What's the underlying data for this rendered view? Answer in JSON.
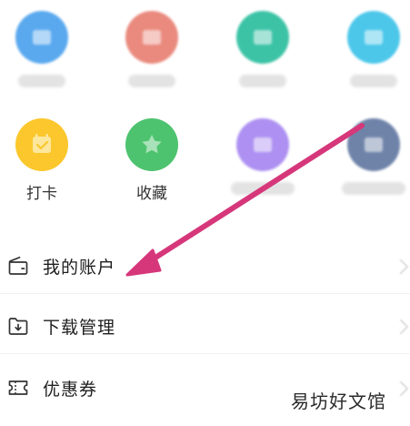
{
  "grid": {
    "row1": [
      {
        "color": "#5aa9ee",
        "label_blurred": true
      },
      {
        "color": "#ea8a7e",
        "label_blurred": true
      },
      {
        "color": "#3cc3a6",
        "label_blurred": true
      },
      {
        "color": "#4cc7ea",
        "label_blurred": true
      }
    ],
    "row2": [
      {
        "color": "#fbc72c",
        "label": "打卡",
        "icon": "calendar-check-icon"
      },
      {
        "color": "#4ec36f",
        "label": "收藏",
        "icon": "star-icon"
      },
      {
        "color": "#ad90f2",
        "label_blurred": true
      },
      {
        "color": "#6f83a9",
        "label_blurred": true
      }
    ]
  },
  "menu": [
    {
      "label": "我的账户",
      "icon": "wallet-icon"
    },
    {
      "label": "下载管理",
      "icon": "download-folder-icon"
    },
    {
      "label": "优惠券",
      "icon": "coupon-icon"
    }
  ],
  "annotation": {
    "arrow_color": "#d6377a"
  },
  "watermark": "易坊好文馆"
}
